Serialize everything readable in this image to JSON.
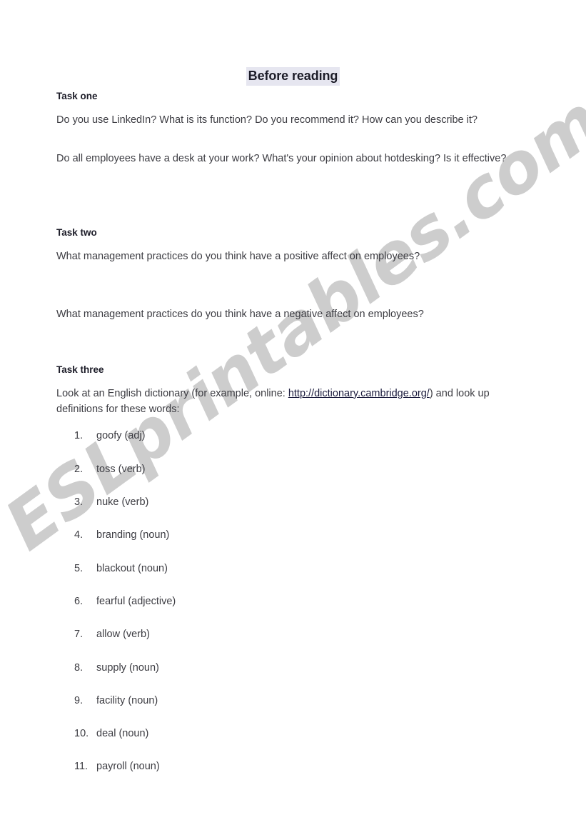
{
  "document": {
    "title": "Before reading",
    "title_highlight_color": "#e6e6f0",
    "text_color": "#3c3c42",
    "heading_color": "#1c1c28",
    "link_color": "#1a1a3c"
  },
  "watermark": {
    "text": "ESLprintables.com",
    "color": "#c9c9c9"
  },
  "tasks": [
    {
      "heading": "Task one",
      "paragraphs": [
        "Do you use LinkedIn? What is its function? Do you recommend it? How can you describe it?",
        "Do all employees have a desk at your work? What's your opinion about hotdesking? Is it effective?"
      ]
    },
    {
      "heading": "Task two",
      "paragraphs": [
        "What management practices do you think have a positive affect on employees?",
        "What management practices do you think have a negative affect on employees?"
      ]
    },
    {
      "heading": "Task three",
      "intro_before_link": "Look at an English dictionary (for example, online: ",
      "link_text": "http://dictionary.cambridge.org/",
      "intro_after_link": ") and look up definitions for these words:",
      "words": [
        {
          "number": "1.",
          "label": "goofy (adj)"
        },
        {
          "number": "2.",
          "label": "toss (verb)"
        },
        {
          "number": "3.",
          "label": "nuke (verb)"
        },
        {
          "number": "4.",
          "label": "branding (noun)"
        },
        {
          "number": "5.",
          "label": "blackout (noun)"
        },
        {
          "number": "6.",
          "label": "fearful (adjective)"
        },
        {
          "number": "7.",
          "label": "allow (verb)"
        },
        {
          "number": "8.",
          "label": "supply (noun)"
        },
        {
          "number": "9.",
          "label": "facility (noun)"
        },
        {
          "number": "10.",
          "label": "deal (noun)"
        },
        {
          "number": "11.",
          "label": "payroll (noun)"
        }
      ]
    }
  ]
}
